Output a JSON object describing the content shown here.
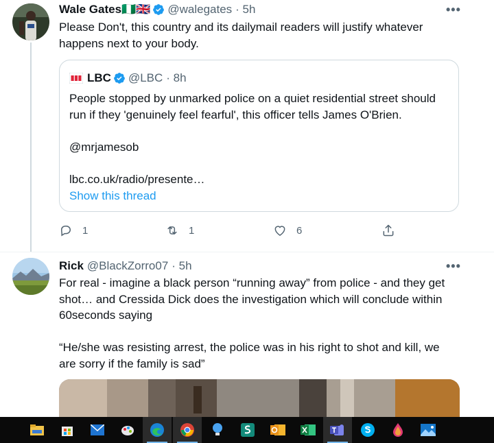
{
  "tweet1": {
    "name": "Wale Gates🇳🇬🇬🇧",
    "handle": "@walegates",
    "time": "· 5h",
    "text_line1": "Please Don't, this country and its dailymail readers will justify whatever",
    "text_line2": "happens next to your body.",
    "quote": {
      "name": "LBC",
      "handle": "@LBC",
      "time": "· 8h",
      "line1": "People stopped by unmarked police on a quiet residential street should",
      "line2": "run if they 'genuinely feel fearful', this officer tells James O'Brien.",
      "mention": "@mrjamesob",
      "link": "lbc.co.uk/radio/presente…",
      "show_thread": "Show this thread"
    },
    "replies": "1",
    "retweets": "1",
    "likes": "6"
  },
  "tweet2": {
    "name": "Rick",
    "handle": "@BlackZorro07",
    "time": "· 5h",
    "line1": "For real - imagine a black person “running away” from police - and they get",
    "line2": "shot… and Cressida Dick does the investigation which will conclude within",
    "line3": "60seconds saying",
    "line4": "“He/she was resisting arrest, the police was in his right to shot and kill, we",
    "line5": "are sorry if the family is sad”"
  },
  "more_glyph": "•••",
  "colors": {
    "link": "#1d9bf0",
    "muted": "#536471",
    "border": "#cfd9de",
    "taskbar": "#0a0a0a"
  },
  "taskbar": {
    "icons": [
      "file-explorer-icon",
      "store-icon",
      "mail-icon",
      "paint-icon",
      "edge-icon",
      "chrome-icon",
      "tips-icon",
      "sway-icon",
      "outlook-icon",
      "excel-icon",
      "teams-icon",
      "skype-icon",
      "paint3d-icon",
      "photos-icon"
    ]
  }
}
